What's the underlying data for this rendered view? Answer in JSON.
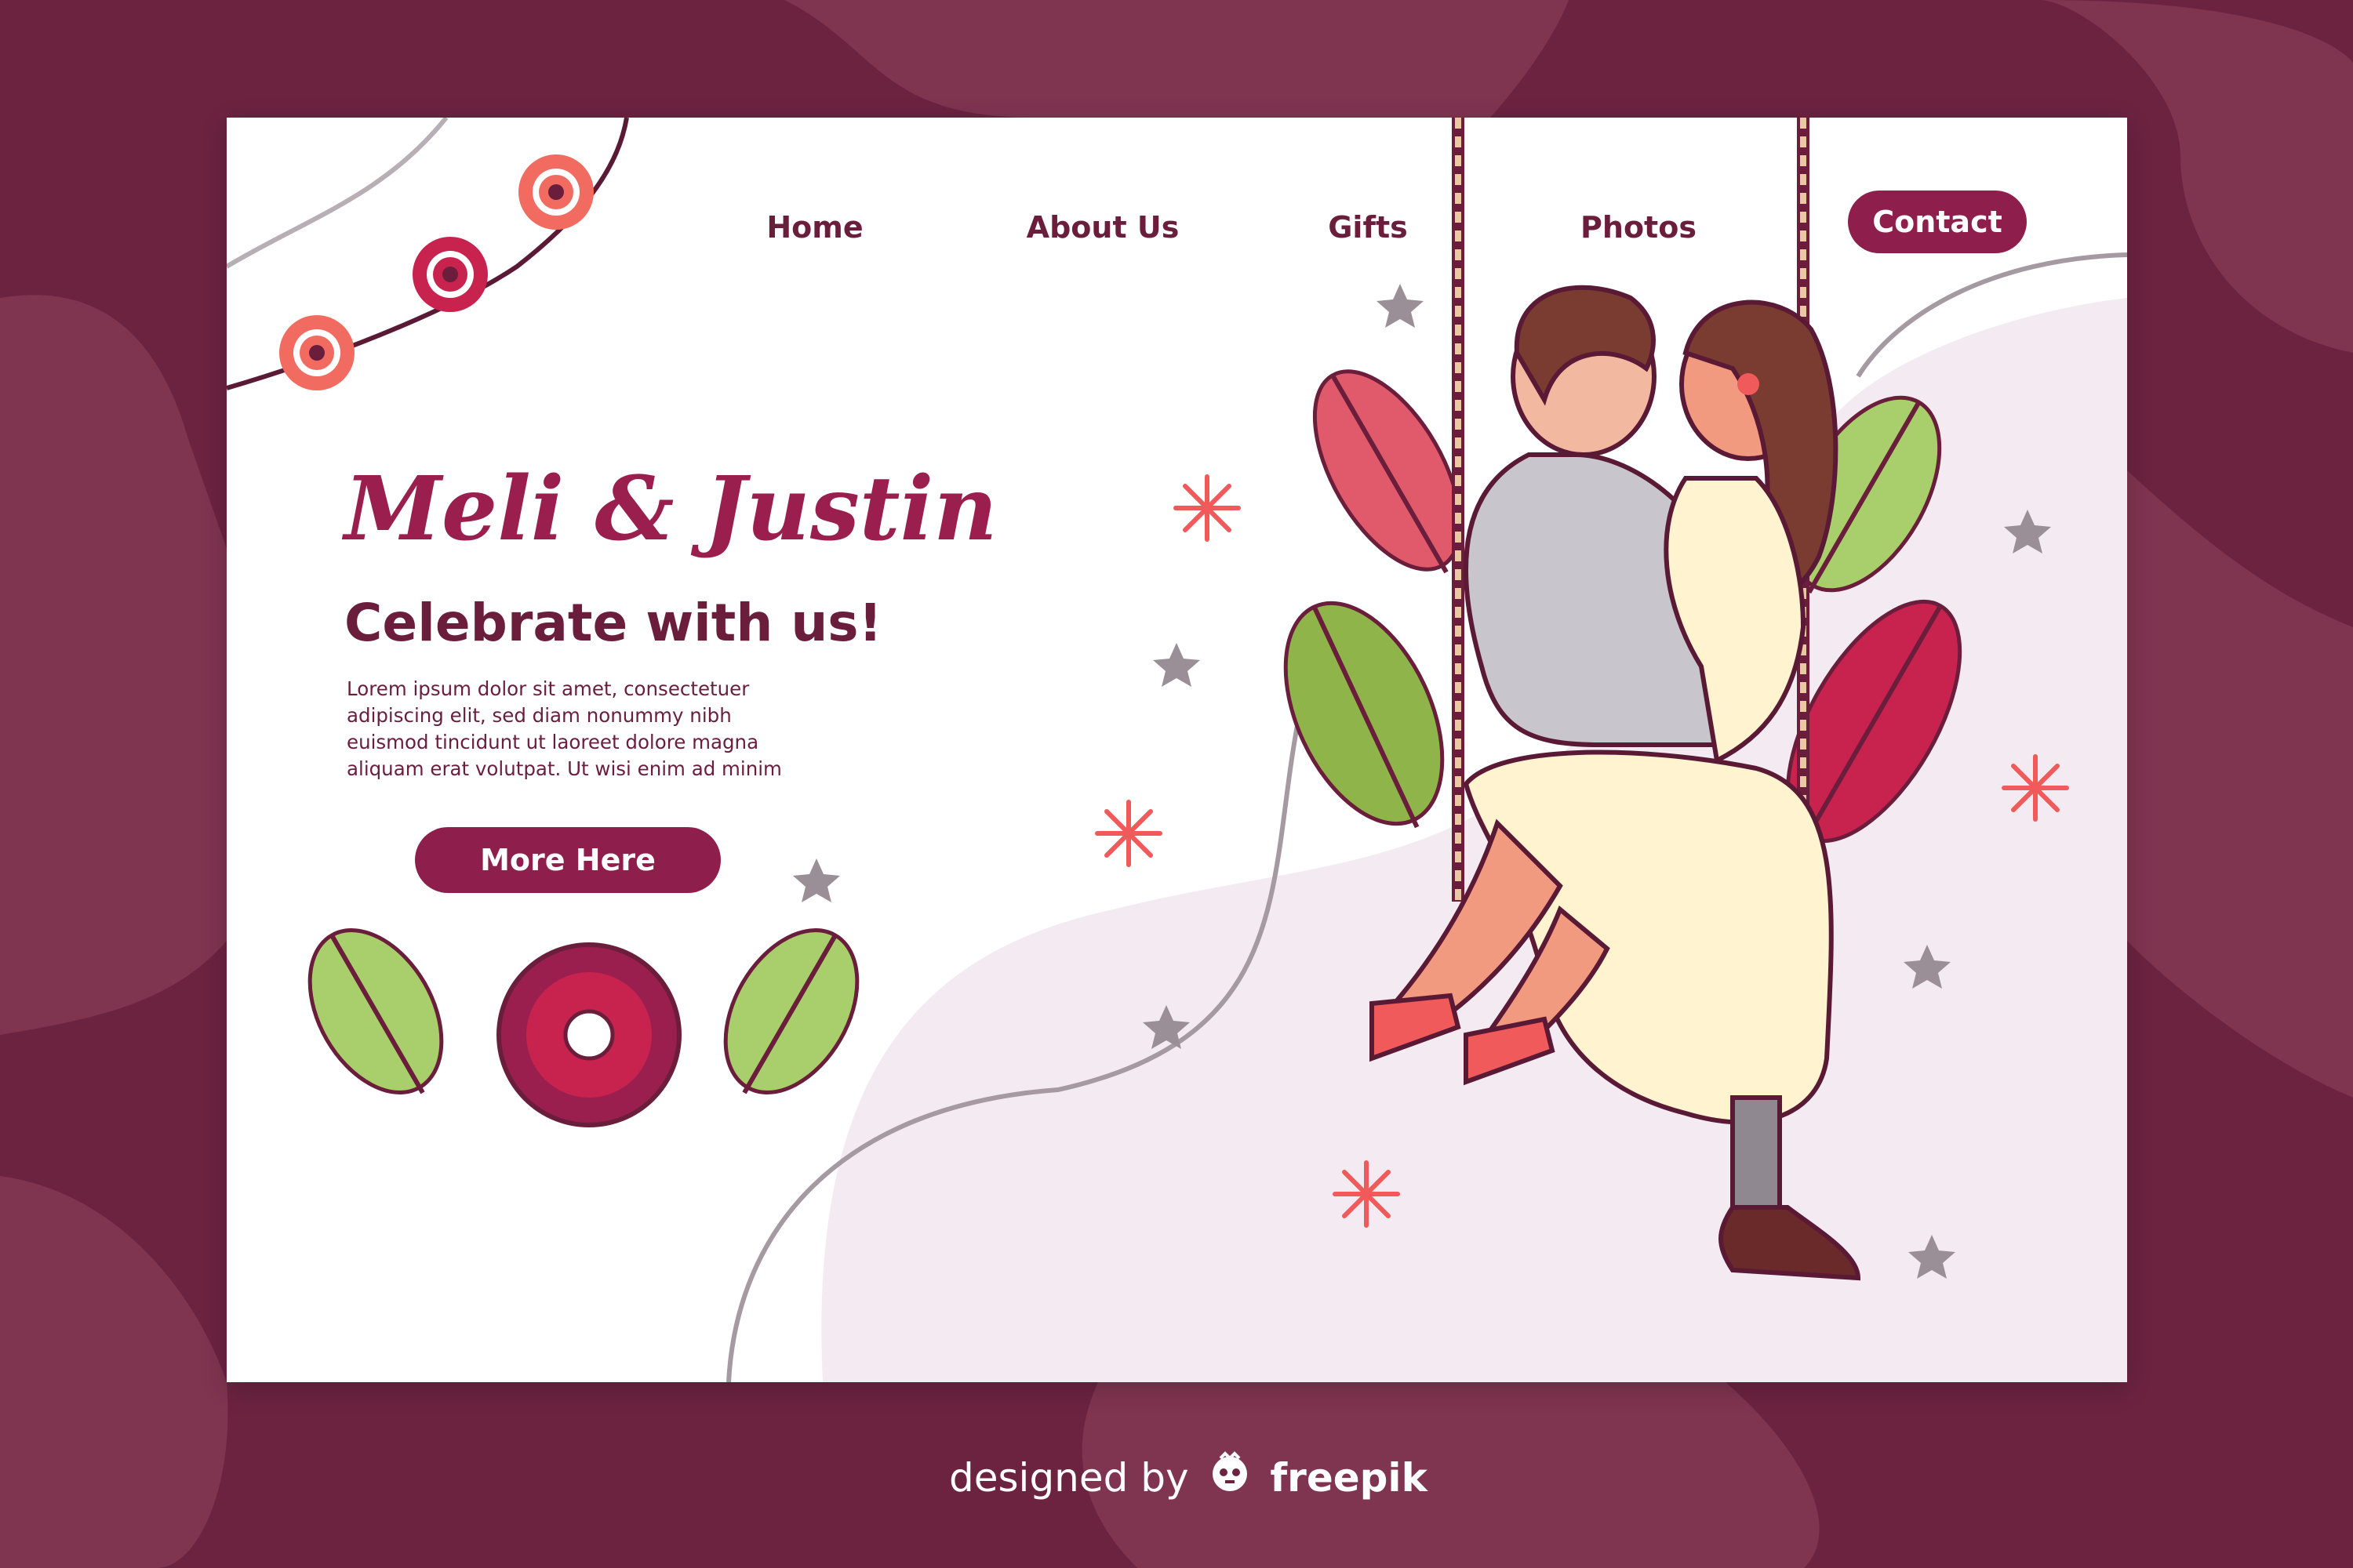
{
  "nav": {
    "items": [
      {
        "label": "Home"
      },
      {
        "label": "About Us"
      },
      {
        "label": "Gifts"
      },
      {
        "label": "Photos"
      }
    ],
    "contact_label": "Contact"
  },
  "hero": {
    "names": "Meli & Justin",
    "headline": "Celebrate with us!",
    "body": "Lorem ipsum dolor sit amet, consectetuer adipiscing elit, sed diam nonummy nibh euismod tincidunt ut laoreet dolore magna aliquam erat volutpat. Ut wisi enim ad minim",
    "button_label": "More Here"
  },
  "footer": {
    "prefix": "designed by",
    "brand": "freepik",
    "logo_icon": "freepik-logo-icon"
  },
  "colors": {
    "background": "#6b2340",
    "accent": "#8e1f4c",
    "text_dark": "#6b1d3c",
    "names": "#9a1f4e"
  }
}
